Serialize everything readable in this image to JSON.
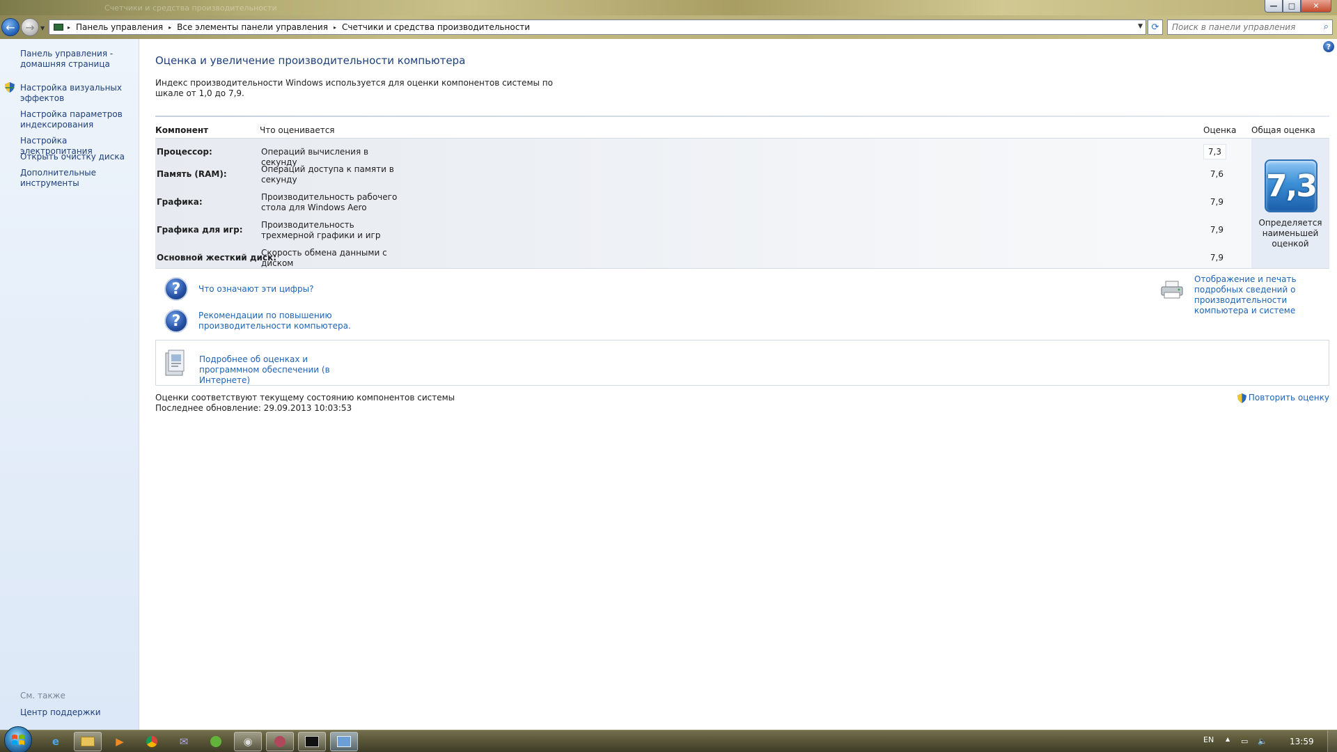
{
  "window": {
    "ghost_title": "Счетчики и средства производительности",
    "buttons": {
      "min": "—",
      "max": "□",
      "close": "✕"
    }
  },
  "nav": {
    "back_glyph": "←",
    "forward_glyph": "→",
    "recent_glyph": "▼",
    "breadcrumbs": [
      "Панель управления",
      "Все элементы панели управления",
      "Счетчики и средства производительности"
    ],
    "crumb_separator": "▸",
    "dropdown_glyph": "▼",
    "refresh_glyph": "⟳",
    "search_placeholder": "Поиск в панели управления"
  },
  "sidebar": {
    "items": [
      {
        "label": "Панель управления - домашняя страница",
        "icon": null
      },
      {
        "label": "Настройка визуальных эффектов",
        "icon": "shield-icon"
      },
      {
        "label": "Настройка параметров индексирования",
        "icon": null
      },
      {
        "label": "Настройка электропитания",
        "icon": null
      },
      {
        "label": "Открыть очистку диска",
        "icon": null
      },
      {
        "label": "Дополнительные инструменты",
        "icon": null
      }
    ],
    "see_also": "См. также",
    "support": "Центр поддержки"
  },
  "main": {
    "title": "Оценка и увеличение производительности компьютера",
    "description": "Индекс производительности Windows используется для оценки компонентов системы по шкале от 1,0 до 7,9.",
    "table": {
      "headers": {
        "component": "Компонент",
        "what": "Что оценивается",
        "score": "Оценка",
        "base": "Общая оценка"
      },
      "rows": [
        {
          "component": "Процессор:",
          "what": "Операций вычисления в секунду",
          "score": "7,3"
        },
        {
          "component": "Память (RAM):",
          "what": "Операций доступа к памяти в секунду",
          "score": "7,6"
        },
        {
          "component": "Графика:",
          "what": "Производительность рабочего стола для Windows Aero",
          "score": "7,9"
        },
        {
          "component": "Графика для игр:",
          "what": "Производительность трехмерной графики и игр",
          "score": "7,9"
        },
        {
          "component": "Основной жесткий диск:",
          "what": "Скорость обмена данными с диском",
          "score": "7,9"
        }
      ],
      "base_score": "7,3",
      "base_caption": "Определяется наименьшей оценкой"
    },
    "links": {
      "what_mean": "Что означают эти цифры?",
      "tips": "Рекомендации по повышению производительности компьютера.",
      "print": "Отображение и печать подробных сведений о производительности компьютера и системе",
      "more_info": "Подробнее об оценках и программном обеспечении (в Интернете)"
    },
    "status_line1": "Оценки соответствуют текущему состоянию компонентов системы",
    "status_line2": "Последнее обновление: 29.09.2013 10:03:53",
    "rerun": "Повторить оценку",
    "help_glyph": "?",
    "question_glyph": "?"
  },
  "taskbar": {
    "apps": [
      "ie-icon",
      "explorer-icon",
      "media-player-icon",
      "chrome-icon",
      "mail-icon",
      "utorrent-icon",
      "app-icon",
      "app2-icon",
      "cmd-icon",
      "performance-icon"
    ],
    "language": "EN",
    "clock": "13:59",
    "tray_arrow": "▲"
  }
}
